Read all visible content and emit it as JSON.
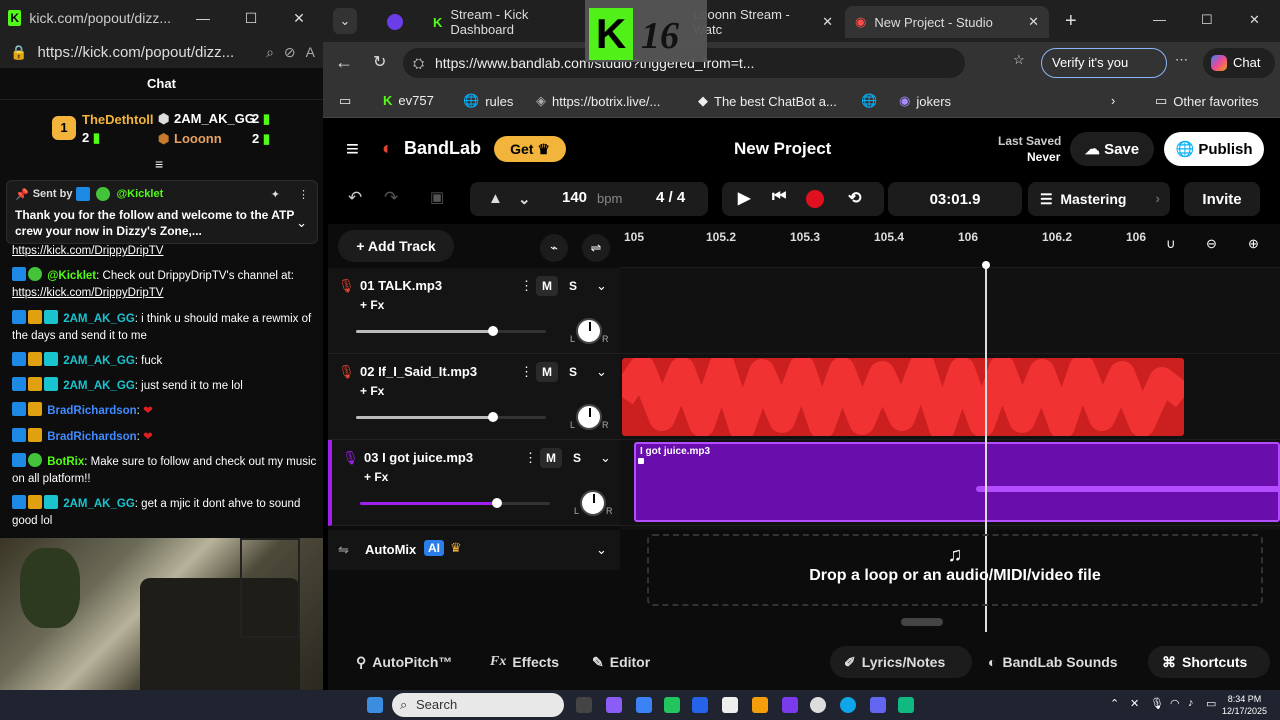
{
  "popout": {
    "title": "kick.com/popout/dizz...",
    "url": "https://kick.com/popout/dizz...",
    "chat_header": "Chat",
    "top_gifters": [
      {
        "rank": "1",
        "name": "TheDethtoll",
        "count": "2"
      },
      {
        "name": "2AM_AK_GG",
        "count": "2"
      },
      {
        "name": "Looonn",
        "count": "2"
      }
    ],
    "pinned": {
      "sent_by_label": "Sent by",
      "sender": "@Kicklet",
      "message": "Thank you for the follow and welcome to the ATP crew your now in Dizzy's Zone,..."
    },
    "messages": [
      {
        "user": "",
        "text": "https://kick.com/DrippyDripTV",
        "is_link": true
      },
      {
        "user": "@Kicklet",
        "user_color": "#53fc18",
        "text": "Check out DrippyDripTV's channel at:"
      },
      {
        "user": "",
        "text": "https://kick.com/DrippyDripTV",
        "is_link": true
      },
      {
        "user": "2AM_AK_GG",
        "user_color": "#19c4cf",
        "text": "i think u should make a rewmix of the days and send it to me"
      },
      {
        "user": "2AM_AK_GG",
        "user_color": "#19c4cf",
        "text": "fuck"
      },
      {
        "user": "2AM_AK_GG",
        "user_color": "#19c4cf",
        "text": "just send it to me lol"
      },
      {
        "user": "BradRichardson",
        "user_color": "#3f8bff",
        "text": "❤"
      },
      {
        "user": "BradRichardson",
        "user_color": "#3f8bff",
        "text": "❤"
      },
      {
        "user": "BotRix",
        "user_color": "#53fc18",
        "text": "Make sure to follow and check out my music on all platform!!"
      },
      {
        "user": "2AM_AK_GG",
        "user_color": "#19c4cf",
        "text": "get a mjic it dont ahve to sound good lol"
      }
    ]
  },
  "browser": {
    "tabs": [
      {
        "label": "Stream - Kick Dashboard"
      },
      {
        "label": "Looonn Stream - Watc"
      },
      {
        "label": "New Project - Studio",
        "active": true
      }
    ],
    "url": "https://www.bandlab.com/studio?triggered_from=t...",
    "verify_label": "Verify it's you",
    "chat_label": "Chat",
    "bookmarks": [
      "ev757",
      "rules",
      "https://botrix.live/...",
      "The best ChatBot a...",
      "",
      "jokers"
    ],
    "other_favorites": "Other favorites",
    "sticker_number": "16"
  },
  "bandlab": {
    "logo": "BandLab",
    "get_label": "Get",
    "project_title": "New Project",
    "last_saved_label": "Last Saved",
    "last_saved_value": "Never",
    "save_label": "Save",
    "publish_label": "Publish",
    "bpm_value": "140",
    "bpm_unit": "bpm",
    "time_sig": "4 / 4",
    "time_display": "03:01.9",
    "mastering_label": "Mastering",
    "invite_label": "Invite",
    "add_track_label": "+ Add Track",
    "ruler_labels": [
      "105",
      "105.2",
      "105.3",
      "105.4",
      "106",
      "106.2",
      "106"
    ],
    "tracks": [
      {
        "name": "01  TALK.mp3",
        "fx": "+ Fx",
        "volume": 0.72,
        "color": "#e3442f"
      },
      {
        "name": "02  If_I_Said_It.mp3",
        "fx": "+ Fx",
        "volume": 0.72,
        "color": "#e3442f"
      },
      {
        "name": "03  I got juice.mp3",
        "fx": "+ Fx",
        "volume": 0.72,
        "color": "#a020f0"
      }
    ],
    "mute_label": "M",
    "solo_label": "S",
    "pan_left": "L",
    "pan_right": "R",
    "clip3_label": "I got juice.mp3",
    "automix_label": "AutoMix",
    "ai_label": "AI",
    "drop_label": "Drop a loop or an audio/MIDI/video file",
    "bottom": {
      "autopitch": "AutoPitch™",
      "effects": "Effects",
      "editor": "Editor",
      "lyrics": "Lyrics/Notes",
      "sounds": "BandLab Sounds",
      "shortcuts": "Shortcuts"
    }
  },
  "taskbar": {
    "search_placeholder": "Search",
    "time": "8:34 PM",
    "date": "12/17/2025"
  },
  "colors": {
    "kick_green": "#53fc18",
    "bandlab_red": "#e3442f",
    "get_gold": "#f2b43b",
    "clip_red": "#cc1f1f",
    "clip_purple": "#6a0dad"
  }
}
